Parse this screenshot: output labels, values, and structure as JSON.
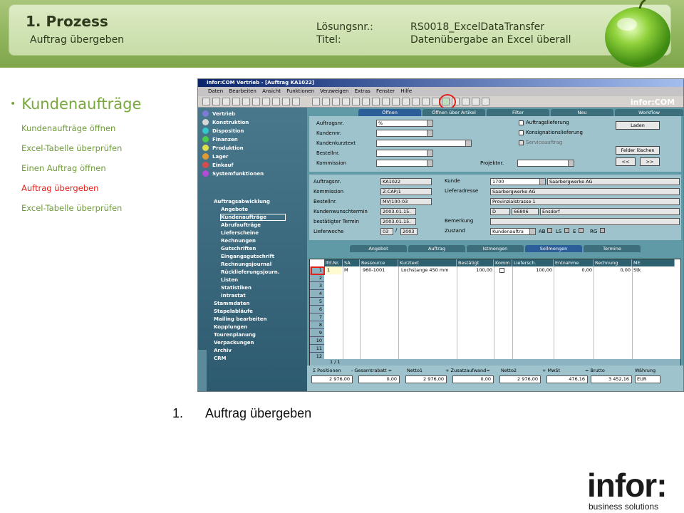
{
  "header": {
    "title": "1. Prozess",
    "subtitle": "Auftrag übergeben",
    "solution_label": "Lösungsnr.:",
    "solution_value": "RS0018_ExcelDataTransfer",
    "title_label": "Titel:",
    "title_value": "Datenübergabe an Excel überall"
  },
  "leftnav": {
    "heading": "Kundenaufträge",
    "items": [
      {
        "label": "Kundenaufträge öffnen",
        "active": false
      },
      {
        "label": "Excel-Tabelle überprüfen",
        "active": false
      },
      {
        "label": "Einen Auftrag öffnen",
        "active": false
      },
      {
        "label": "Auftrag übergeben",
        "active": true
      },
      {
        "label": "Excel-Tabelle überprüfen",
        "active": false
      }
    ]
  },
  "caption": {
    "number": "1.",
    "text": "Auftrag übergeben"
  },
  "logo": {
    "brand": "infor:",
    "tagline": "business solutions"
  },
  "app": {
    "window_title": "infor:COM Vertrieb - [Auftrag KA1022]",
    "menu": [
      "Daten",
      "Bearbeiten",
      "Ansicht",
      "Funktionen",
      "Verzweigen",
      "Extras",
      "Fenster",
      "Hilfe"
    ],
    "brand_mini": "infor:COM",
    "modules": [
      "Vertrieb",
      "Konstruktion",
      "Disposition",
      "Finanzen",
      "Produktion",
      "Lager",
      "Einkauf",
      "Systemfunktionen"
    ],
    "tree": [
      "Auftragsabwicklung",
      "Angebote",
      "Kundenaufträge",
      "Abrufaufträge",
      "Lieferscheine",
      "Rechnungen",
      "Gutschriften",
      "Eingangsgutschrift",
      "Rechnungsjournal",
      "Rücklieferungsjourn.",
      "Listen",
      "Statistiken",
      "Intrastat",
      "Stammdaten",
      "Stapelabläufe",
      "Mailing bearbeiten",
      "Kopplungen",
      "Tourenplanung",
      "Verpackungen",
      "Archiv",
      "CRM"
    ],
    "top_tabs": [
      "Öffnen",
      "Öffnen über Artikel",
      "Filter",
      "Neu",
      "Workflow"
    ],
    "search": {
      "labels": [
        "Auftragsnr.",
        "Kundennr.",
        "Kundenkurztext",
        "Bestellnr.",
        "Kommission"
      ],
      "auftragsnr_value": "%",
      "projektnr_label": "Projektnr.",
      "checks": [
        {
          "label": "Auftragslieferung",
          "checked": true
        },
        {
          "label": "Konsignationslieferung",
          "checked": false
        },
        {
          "label": "Serviceauftrag",
          "checked": true
        }
      ],
      "btn_load": "Laden",
      "btn_clear": "Felder löschen",
      "btn_prev": "<<",
      "btn_next": ">>"
    },
    "order": {
      "labels": [
        "Auftragsnr.",
        "Kommission",
        "Bestellnr.",
        "Kundenwunschtermin",
        "bestätigter Termin",
        "Lieferwoche"
      ],
      "auftragsnr": "KA1022",
      "kommission": "Z-CAP/1",
      "bestellnr": "MV/100-03",
      "wunschtermin": "2003.01.15.",
      "bestaetigt": "2003.01.15.",
      "lieferwoche_week": "03",
      "lieferwoche_sep": "/",
      "lieferwoche_year": "2003",
      "kunde_label": "Kunde",
      "kunde_nr": "1700",
      "kunde_name": "Saarbergwerke AG",
      "lieferadresse_label": "Lieferadresse",
      "lieferadresse": "Saarbergwerke AG",
      "strasse": "Provinzialstrasse 1",
      "land": "D",
      "plz": "66806",
      "ort": "Ensdorf",
      "bemerkung_label": "Bemerkung",
      "zustand_label": "Zustand",
      "zustand": "Kundenauftra",
      "flags": [
        "AB",
        "LS",
        "E",
        "RG"
      ]
    },
    "grid_tabs": [
      "Angebot",
      "Auftrag",
      "Istmengen",
      "Sollmengen",
      "Termine"
    ],
    "grid_headers": [
      "lfd.Nr.",
      "SA",
      "Ressource",
      "Kurztext",
      "Bestätigt",
      "Komm",
      "Liefersch.",
      "Entnahme",
      "Rechnung",
      "ME"
    ],
    "row1": {
      "nr": "1",
      "sa": "M",
      "ressource": "960-1001",
      "kurztext": "Lochstange 450 mm",
      "bestaetigt": "100,00",
      "liefersch": "100,00",
      "entnahme": "0,00",
      "rechnung": "0,00",
      "me": "Stk"
    },
    "row_numbers": [
      "1",
      "2",
      "3",
      "4",
      "5",
      "6",
      "7",
      "8",
      "9",
      "10",
      "11",
      "12"
    ],
    "pager": "1 / 1",
    "summary_labels": [
      "Σ Positionen",
      "- Gesamtrabatt =",
      "Netto1",
      "+ Zusatzaufwand=",
      "Netto2",
      "+ MwSt",
      "= Brutto",
      "Währung"
    ],
    "summary_values": [
      "2 976,00",
      "0,00",
      "2 976,00",
      "0,00",
      "2 976,00",
      "476,16",
      "3 452,16",
      "EUR"
    ]
  }
}
